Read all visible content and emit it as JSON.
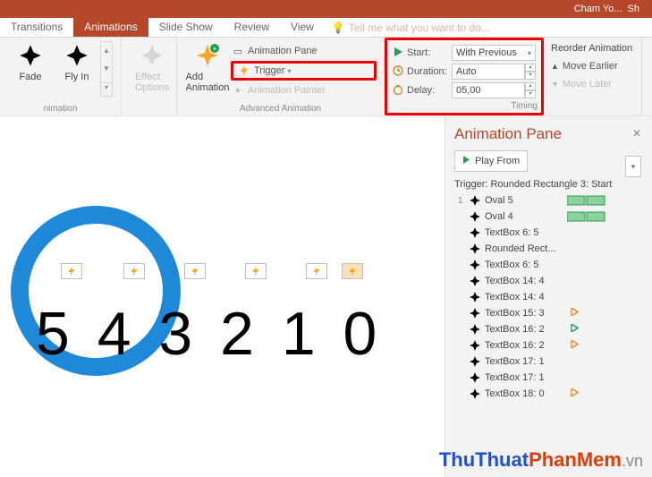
{
  "titlebar": {
    "user": "Cham Yo...",
    "share": "Sh"
  },
  "tabs": {
    "items": [
      "Transitions",
      "Animations",
      "Slide Show",
      "Review",
      "View"
    ],
    "active_index": 1,
    "tell_me": "Tell me what you want to do..."
  },
  "ribbon": {
    "gallery": {
      "fade": "Fade",
      "flyin": "Fly In"
    },
    "effect_options": "Effect\nOptions",
    "advanced": {
      "add_animation": "Add\nAnimation",
      "animation_pane": "Animation Pane",
      "trigger": "Trigger",
      "animation_painter": "Animation Painter",
      "group_label": "Advanced Animation"
    },
    "timing": {
      "start_label": "Start:",
      "start_value": "With Previous",
      "duration_label": "Duration:",
      "duration_value": "Auto",
      "delay_label": "Delay:",
      "delay_value": "05,00",
      "group_label": "Timing"
    },
    "reorder": {
      "title": "Reorder Animation",
      "earlier": "Move Earlier",
      "later": "Move Later"
    },
    "nimation_label": "nimation"
  },
  "slide": {
    "numbers": "5 4 3 2 1 0"
  },
  "panel": {
    "title": "Animation Pane",
    "play_from": "Play From",
    "trigger_header": "Trigger: Rounded Rectangle 3: Start",
    "items": [
      {
        "num": "1",
        "star": "green",
        "label": "Oval 5",
        "bar": "double-green"
      },
      {
        "num": "",
        "star": "green",
        "label": "Oval 4",
        "bar": "double-green"
      },
      {
        "num": "",
        "star": "orange",
        "label": "TextBox 6: 5",
        "bar": ""
      },
      {
        "num": "",
        "star": "orange",
        "label": "Rounded Rect...",
        "bar": ""
      },
      {
        "num": "",
        "star": "orange",
        "label": "TextBox 6: 5",
        "bar": ""
      },
      {
        "num": "",
        "star": "teal",
        "label": "TextBox 14: 4",
        "bar": ""
      },
      {
        "num": "",
        "star": "orange",
        "label": "TextBox 14: 4",
        "bar": ""
      },
      {
        "num": "",
        "star": "orange",
        "label": "TextBox 15: 3",
        "bar": "",
        "tri": "orange"
      },
      {
        "num": "",
        "star": "teal",
        "label": "TextBox 16: 2",
        "bar": "",
        "tri": "green"
      },
      {
        "num": "",
        "star": "orange",
        "label": "TextBox 16: 2",
        "bar": "",
        "tri": "orange"
      },
      {
        "num": "",
        "star": "orange",
        "label": "TextBox 17: 1",
        "bar": ""
      },
      {
        "num": "",
        "star": "teal",
        "label": "TextBox 17: 1",
        "bar": ""
      },
      {
        "num": "",
        "star": "orange",
        "label": "TextBox 18: 0",
        "bar": "",
        "tri": "orange"
      }
    ]
  },
  "watermark": {
    "p1": "ThuThuat",
    "p2": "PhanMem",
    "p3": ".vn"
  }
}
